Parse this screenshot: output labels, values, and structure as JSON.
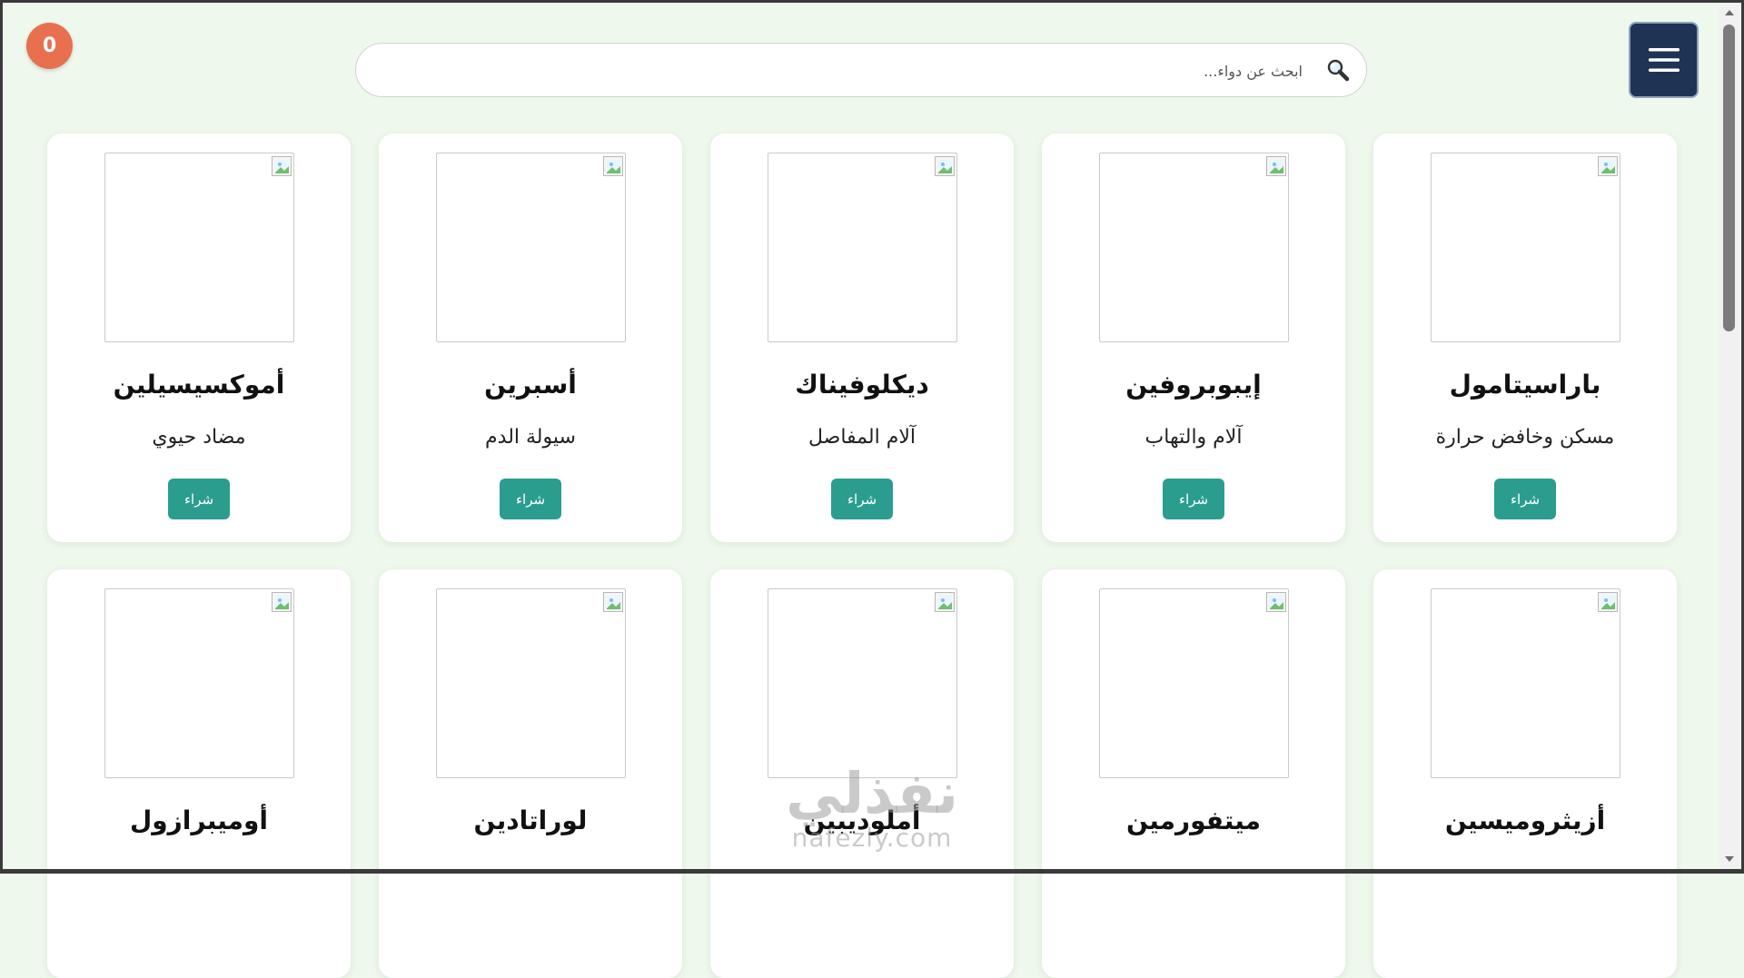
{
  "cart": {
    "count": "0"
  },
  "menu": {
    "icon": "hamburger-icon"
  },
  "search": {
    "placeholder": "ابحث عن دواء...",
    "icon": "magnifier-icon"
  },
  "colors": {
    "accent": "#2a9d8f",
    "badge": "#e8704e",
    "menu_bg": "#1f3354",
    "page_bg": "#eef8ec"
  },
  "products": [
    {
      "name": "باراسيتامول",
      "desc": "مسكن وخافض حرارة",
      "buy_label": "شراء"
    },
    {
      "name": "إيبوبروفين",
      "desc": "آلام والتهاب",
      "buy_label": "شراء"
    },
    {
      "name": "ديكلوفيناك",
      "desc": "آلام المفاصل",
      "buy_label": "شراء"
    },
    {
      "name": "أسبرين",
      "desc": "سيولة الدم",
      "buy_label": "شراء"
    },
    {
      "name": "أموكسيسيلين",
      "desc": "مضاد حيوي",
      "buy_label": "شراء"
    },
    {
      "name": "أزيثروميسين",
      "desc": "",
      "buy_label": ""
    },
    {
      "name": "ميتفورمين",
      "desc": "",
      "buy_label": ""
    },
    {
      "name": "أملوديبين",
      "desc": "",
      "buy_label": ""
    },
    {
      "name": "لوراتادين",
      "desc": "",
      "buy_label": ""
    },
    {
      "name": "أوميبرازول",
      "desc": "",
      "buy_label": ""
    }
  ],
  "watermark": {
    "arabic": "نفذلي",
    "latin": "nafezly.com"
  }
}
